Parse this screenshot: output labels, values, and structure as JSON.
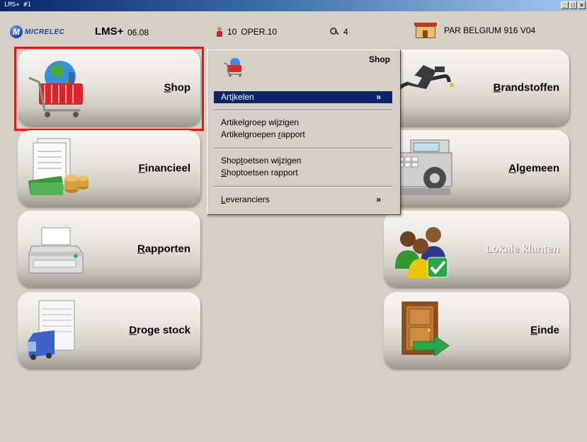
{
  "window": {
    "title": "LMS+ #1",
    "controls": [
      "_",
      "×",
      "□"
    ]
  },
  "header": {
    "logo_text": "MICRELEC",
    "logo_letter": "M",
    "app_name": "LMS+",
    "app_version": "06.08",
    "operator_number": "10",
    "operator_name": "OPER.10",
    "keys_count": "4",
    "station_name": "PAR BELGIUM 916 V04"
  },
  "menu": {
    "shop": {
      "underline": "S",
      "rest": "hop"
    },
    "financieel": {
      "underline": "F",
      "rest": "inancieel"
    },
    "rapporten": {
      "underline": "R",
      "rest": "apporten"
    },
    "droge_stock": {
      "underline": "D",
      "rest": "roge stock"
    },
    "brandstoffen": {
      "underline": "B",
      "rest": "randstoffen"
    },
    "algemeen": {
      "underline": "A",
      "rest": "lgemeen"
    },
    "lokale_klanten": {
      "label": "Lokale klanten"
    },
    "einde": {
      "underline": "E",
      "rest": "inde"
    }
  },
  "dropdown": {
    "title": "Shop",
    "items": [
      {
        "pre": "Art",
        "u": "i",
        "post": "kelen",
        "arrow": "»"
      },
      {
        "pre": "Artikel",
        "u": "g",
        "post": "roep wijzigen"
      },
      {
        "pre": "Artikelgroepen ",
        "u": "r",
        "post": "apport"
      },
      {
        "pre": "Shop",
        "u": "t",
        "post": "oetsen wijzigen"
      },
      {
        "pre": "",
        "u": "S",
        "post": "hoptoetsen rapport"
      },
      {
        "pre": "",
        "u": "L",
        "post": "everanciers",
        "arrow": "»"
      }
    ]
  }
}
